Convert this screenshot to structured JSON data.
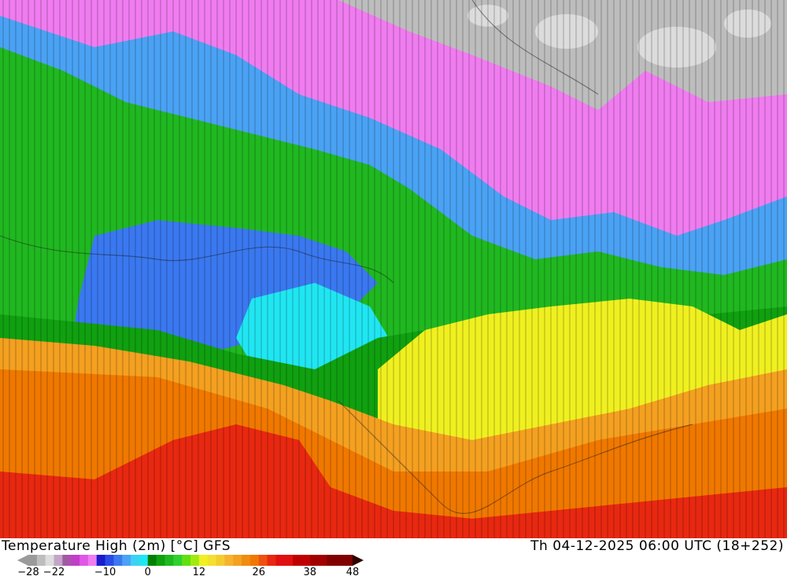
{
  "title": "Temperature High (2m) [°C] GFS",
  "valid_time": "Th 04-12-2025 06:00 UTC (18+252)",
  "unit": "°C",
  "colorbar": {
    "ticks": [
      "-28",
      "-22",
      "-10",
      "0",
      "12",
      "26",
      "38",
      "48"
    ],
    "stops": [
      {
        "v": -28,
        "c": "#9a9a9a"
      },
      {
        "v": -26,
        "c": "#bdbdbd"
      },
      {
        "v": -24,
        "c": "#dddddd"
      },
      {
        "v": -22,
        "c": "#c2a6c6"
      },
      {
        "v": -20,
        "c": "#a557a7"
      },
      {
        "v": -18,
        "c": "#c03ec8"
      },
      {
        "v": -16,
        "c": "#e056e6"
      },
      {
        "v": -14,
        "c": "#f07cf0"
      },
      {
        "v": -12,
        "c": "#1a1ad0"
      },
      {
        "v": -10,
        "c": "#2a4ae6"
      },
      {
        "v": -8,
        "c": "#3a78f0"
      },
      {
        "v": -6,
        "c": "#4aa2f4"
      },
      {
        "v": -4,
        "c": "#3ad2f6"
      },
      {
        "v": -2,
        "c": "#20e6f2"
      },
      {
        "v": 0,
        "c": "#008000"
      },
      {
        "v": 2,
        "c": "#10a010"
      },
      {
        "v": 4,
        "c": "#20b820"
      },
      {
        "v": 6,
        "c": "#30d030"
      },
      {
        "v": 8,
        "c": "#60e010"
      },
      {
        "v": 10,
        "c": "#a0ea10"
      },
      {
        "v": 12,
        "c": "#f0f020"
      },
      {
        "v": 14,
        "c": "#f4e030"
      },
      {
        "v": 16,
        "c": "#f4cc30"
      },
      {
        "v": 18,
        "c": "#f4b430"
      },
      {
        "v": 20,
        "c": "#f4a020"
      },
      {
        "v": 22,
        "c": "#f08c10"
      },
      {
        "v": 24,
        "c": "#f07800"
      },
      {
        "v": 26,
        "c": "#f05010"
      },
      {
        "v": 28,
        "c": "#e82810"
      },
      {
        "v": 30,
        "c": "#e01010"
      },
      {
        "v": 34,
        "c": "#c00000"
      },
      {
        "v": 38,
        "c": "#a00000"
      },
      {
        "v": 42,
        "c": "#800000"
      },
      {
        "v": 48,
        "c": "#400000"
      }
    ]
  }
}
